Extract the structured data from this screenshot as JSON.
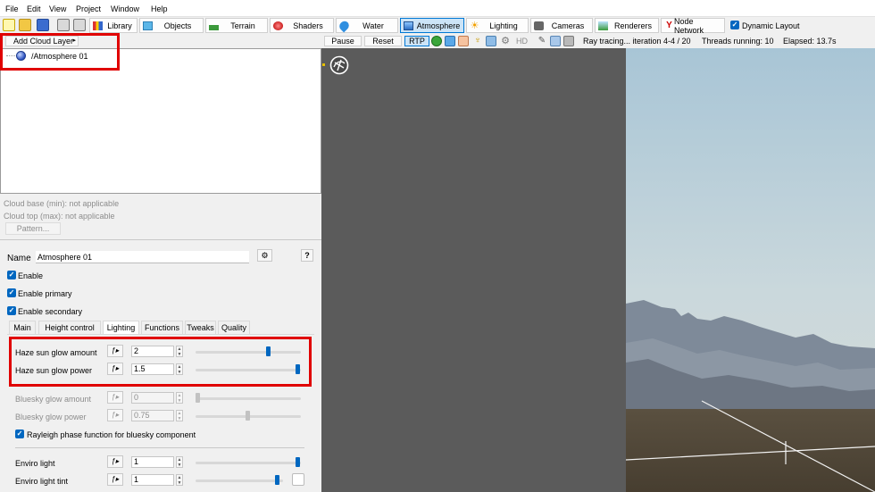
{
  "menu": [
    "File",
    "Edit",
    "View",
    "Project",
    "Window",
    "Help"
  ],
  "toolbar": {
    "tabs": [
      {
        "label": "Library",
        "icon": "library-icon"
      },
      {
        "label": "Objects",
        "icon": "objects-cube-icon"
      },
      {
        "label": "Terrain",
        "icon": "terrain-icon"
      },
      {
        "label": "Shaders",
        "icon": "shaders-sphere-icon"
      },
      {
        "label": "Water",
        "icon": "water-drop-icon"
      },
      {
        "label": "Atmosphere",
        "icon": "atmosphere-icon"
      },
      {
        "label": "Lighting",
        "icon": "sun-icon"
      },
      {
        "label": "Cameras",
        "icon": "camera-icon"
      },
      {
        "label": "Renderers",
        "icon": "renderer-icon"
      },
      {
        "label": "Node Network",
        "icon": "node-network-icon"
      }
    ],
    "active_tab": "Atmosphere",
    "dynamic_layout": "Dynamic Layout"
  },
  "left": {
    "add_cloud_layer": "Add Cloud Layer",
    "tree_item": "/Atmosphere 01",
    "cloud_base": "Cloud base (min): not applicable",
    "cloud_top": "Cloud top (max): not applicable",
    "pattern_button": "Pattern...",
    "name_label": "Name",
    "name_value": "Atmosphere 01",
    "help": "?",
    "enable": "Enable",
    "enable_primary": "Enable primary",
    "enable_secondary": "Enable secondary",
    "tabs": [
      "Main",
      "Height control",
      "Lighting",
      "Functions",
      "Tweaks",
      "Quality"
    ],
    "selected_tab": "Lighting",
    "params": {
      "haze_amount": {
        "label": "Haze sun glow amount",
        "value": "2"
      },
      "haze_power": {
        "label": "Haze sun glow power",
        "value": "1.5"
      },
      "bluesky_amount": {
        "label": "Bluesky glow amount",
        "value": "0"
      },
      "bluesky_power": {
        "label": "Bluesky glow power",
        "value": "0.75"
      },
      "rayleigh": "Rayleigh phase function for bluesky component",
      "enviro_light": {
        "label": "Enviro light",
        "value": "1"
      },
      "enviro_tint": {
        "label": "Enviro light tint",
        "value": "1"
      }
    }
  },
  "viewport": {
    "pause": "Pause",
    "reset": "Reset",
    "rtp": "RTP",
    "hd": "HD",
    "status": "Ray tracing... iteration 4-4 / 20",
    "threads": "Threads running: 10",
    "elapsed": "Elapsed: 13.7s"
  },
  "colors": {
    "accent": "#0067c0",
    "highlight": "#e00000",
    "viewport_gray": "#5b5b5b"
  }
}
